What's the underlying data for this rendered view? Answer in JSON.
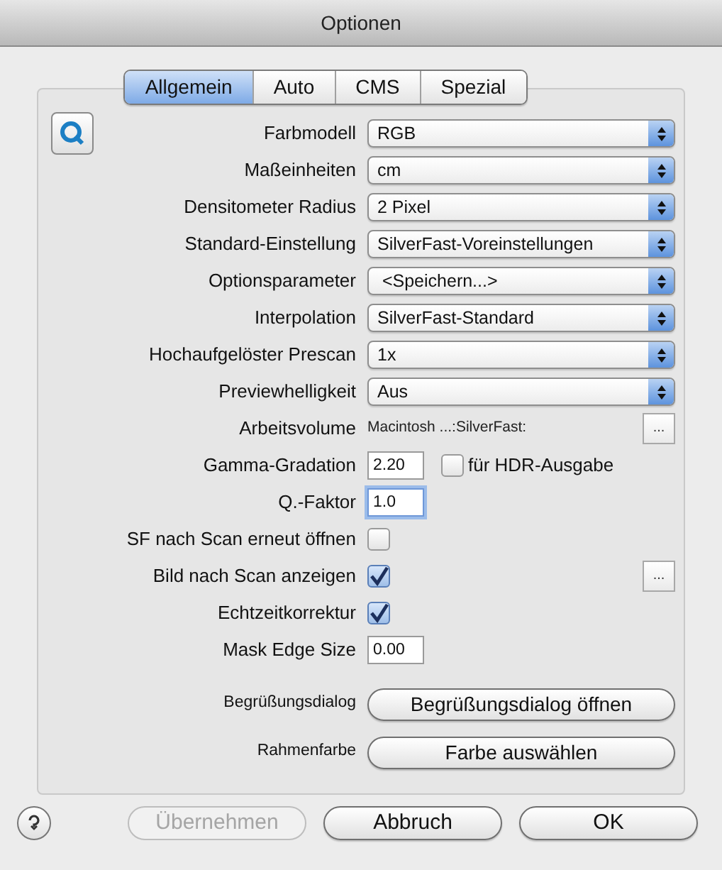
{
  "window": {
    "title": "Optionen"
  },
  "tabs": [
    {
      "label": "Allgemein",
      "selected": true
    },
    {
      "label": "Auto",
      "selected": false
    },
    {
      "label": "CMS",
      "selected": false
    },
    {
      "label": "Spezial",
      "selected": false
    }
  ],
  "rows": [
    {
      "kind": "select",
      "label": "Farbmodell",
      "value": "RGB"
    },
    {
      "kind": "select",
      "label": "Maßeinheiten",
      "value": "cm"
    },
    {
      "kind": "select",
      "label": "Densitometer Radius",
      "value": "2 Pixel"
    },
    {
      "kind": "select",
      "label": "Standard-Einstellung",
      "value": "SilverFast-Voreinstellungen"
    },
    {
      "kind": "select",
      "label": "Optionsparameter",
      "value": " <Speichern...>"
    },
    {
      "kind": "select",
      "label": "Interpolation",
      "value": "SilverFast-Standard"
    },
    {
      "kind": "select",
      "label": "Hochaufgelöster Prescan",
      "value": "1x"
    },
    {
      "kind": "select",
      "label": "Previewhelligkeit",
      "value": "Aus"
    },
    {
      "kind": "path",
      "label": "Arbeitsvolume",
      "value": "Macintosh ...:SilverFast:",
      "button": "..."
    },
    {
      "kind": "input",
      "label": "Gamma-Gradation",
      "value": "2.20",
      "focused": false,
      "checkbox": {
        "label": "für HDR-Ausgabe",
        "checked": false
      }
    },
    {
      "kind": "input",
      "label": "Q.-Faktor",
      "value": "1.0",
      "focused": true
    },
    {
      "kind": "checkbox",
      "label": "SF nach Scan erneut öffnen",
      "checked": false
    },
    {
      "kind": "checkbox",
      "label": "Bild nach Scan anzeigen",
      "checked": true,
      "button": "..."
    },
    {
      "kind": "checkbox",
      "label": "Echtzeitkorrektur",
      "checked": true
    },
    {
      "kind": "input",
      "label": "Mask Edge Size",
      "value": "0.00",
      "focused": false
    },
    {
      "kind": "button",
      "label": "Begrüßungsdialog",
      "button": "Begrüßungsdialog öffnen"
    },
    {
      "kind": "button",
      "label": "Rahmenfarbe",
      "button": "Farbe auswählen"
    }
  ],
  "footer_buttons": [
    {
      "label": "Übernehmen",
      "disabled": true
    },
    {
      "label": "Abbruch",
      "disabled": false
    },
    {
      "label": "OK",
      "disabled": false
    }
  ]
}
